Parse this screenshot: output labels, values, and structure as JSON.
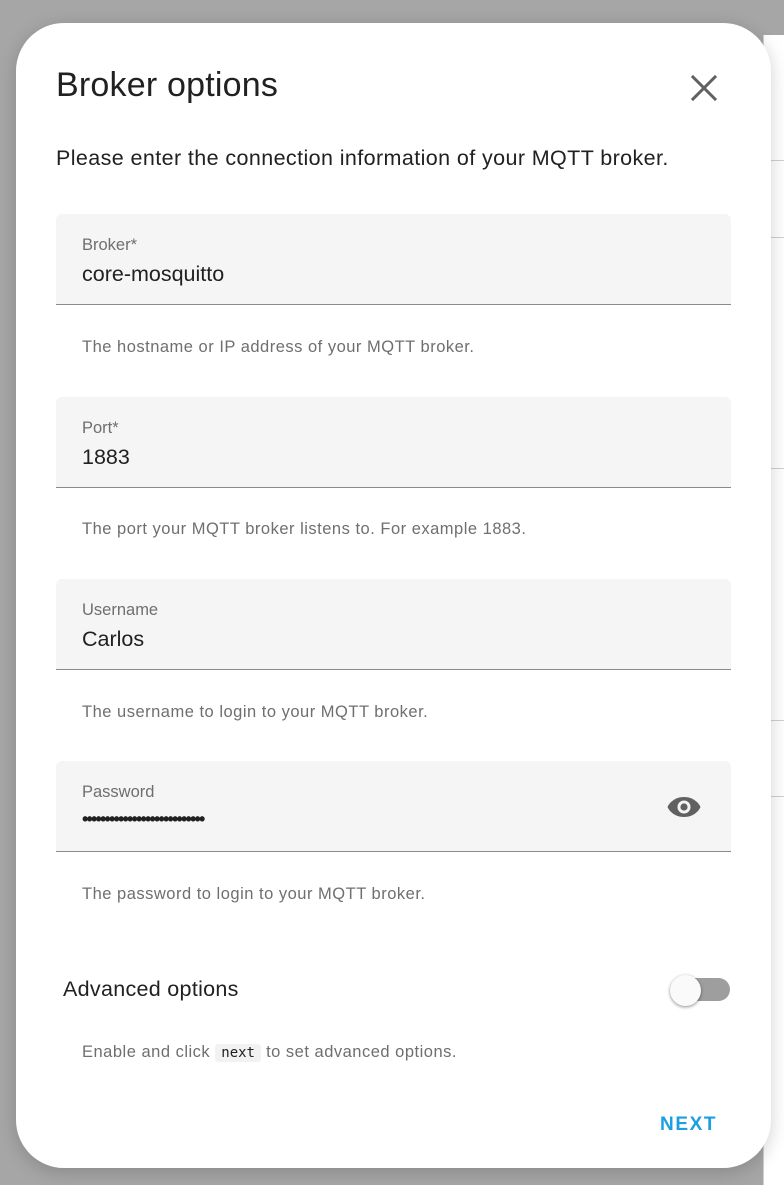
{
  "dialog": {
    "title": "Broker options",
    "intro": "Please enter the connection information of your MQTT broker."
  },
  "fields": {
    "broker": {
      "label": "Broker*",
      "value": "core-mosquitto",
      "helper": "The hostname or IP address of your MQTT broker."
    },
    "port": {
      "label": "Port*",
      "value": "1883",
      "helper": "The port your MQTT broker listens to. For example 1883."
    },
    "username": {
      "label": "Username",
      "value": "Carlos",
      "helper": "The username to login to your MQTT broker."
    },
    "password": {
      "label": "Password",
      "value": "•••••••••••••••••••••••••••",
      "helper": "The password to login to your MQTT broker."
    }
  },
  "advanced": {
    "label": "Advanced options",
    "enabled": false,
    "helper_before": "Enable and click",
    "helper_code": "next",
    "helper_after": "to set advanced options."
  },
  "actions": {
    "next_label": "NEXT"
  },
  "icons": {
    "close": "close-icon",
    "password_visibility": "eye-icon"
  },
  "colors": {
    "accent": "#1a9fe0",
    "field_background": "#f5f5f5",
    "switch_off_track": "#9e9e9e"
  }
}
